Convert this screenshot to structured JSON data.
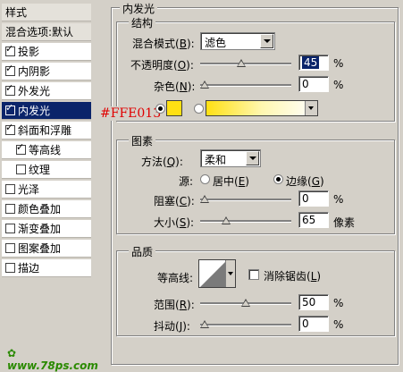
{
  "styles_panel": {
    "header": "样式",
    "blend_options": "混合选项:默认",
    "items": [
      {
        "label": "投影",
        "checked": true
      },
      {
        "label": "内阴影",
        "checked": true
      },
      {
        "label": "外发光",
        "checked": true
      },
      {
        "label": "内发光",
        "checked": true,
        "selected": true
      },
      {
        "label": "斜面和浮雕",
        "checked": true
      },
      {
        "label": "等高线",
        "checked": true,
        "sub": true
      },
      {
        "label": "纹理",
        "checked": false,
        "sub": true
      },
      {
        "label": "光泽",
        "checked": false
      },
      {
        "label": "颜色叠加",
        "checked": false
      },
      {
        "label": "渐变叠加",
        "checked": false
      },
      {
        "label": "图案叠加",
        "checked": false
      },
      {
        "label": "描边",
        "checked": false
      }
    ]
  },
  "panel_title": "内发光",
  "structure": {
    "title": "结构",
    "blend_mode_label": "混合模式",
    "blend_mode_key": "B",
    "blend_mode_value": "滤色",
    "opacity_label": "不透明度",
    "opacity_key": "O",
    "opacity_value": "45",
    "opacity_fraction": 0.45,
    "noise_label": "杂色",
    "noise_key": "N",
    "noise_value": "0",
    "noise_fraction": 0,
    "color_annotation": "#FFE013",
    "glow_color": "#ffe013",
    "percent": "%"
  },
  "elements": {
    "title": "图素",
    "method_label": "方法",
    "method_key": "Q",
    "method_value": "柔和",
    "source_label": "源:",
    "source_center": "居中",
    "source_center_key": "E",
    "source_edge": "边缘",
    "source_edge_key": "G",
    "choke_label": "阻塞",
    "choke_key": "C",
    "choke_value": "0",
    "choke_fraction": 0,
    "size_label": "大小",
    "size_key": "S",
    "size_value": "65",
    "size_fraction": 0.26,
    "size_unit": "像素",
    "percent": "%"
  },
  "quality": {
    "title": "品质",
    "contour_label": "等高线:",
    "antialias_label": "消除锯齿",
    "antialias_key": "L",
    "range_label": "范围",
    "range_key": "R",
    "range_value": "50",
    "range_fraction": 0.5,
    "jitter_label": "抖动",
    "jitter_key": "J",
    "jitter_value": "0",
    "jitter_fraction": 0,
    "percent": "%"
  },
  "watermark": "www.78ps.com"
}
